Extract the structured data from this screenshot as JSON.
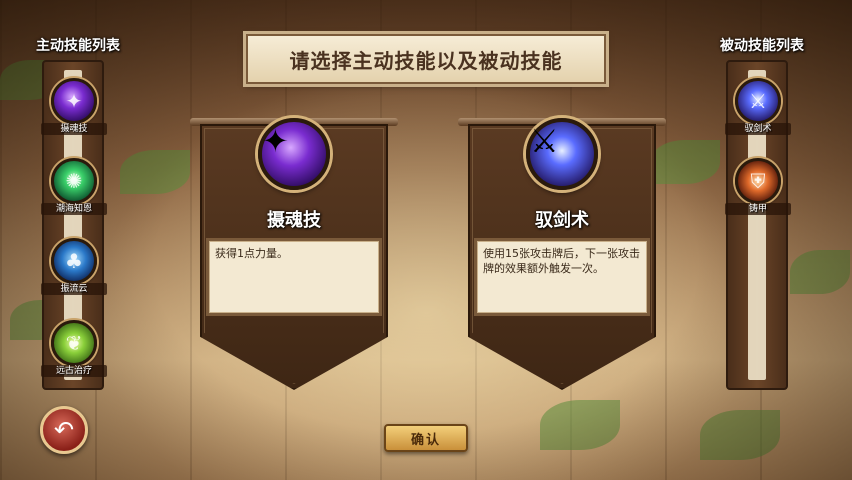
{
  "header": {
    "title": "请选择主动技能以及被动技能"
  },
  "active_list": {
    "heading": "主动技能列表",
    "items": [
      {
        "label": "摄魂技",
        "icon": "soul-claw-icon",
        "color": "#7a2cd0"
      },
      {
        "label": "潮海知恩",
        "icon": "green-burst-icon",
        "color": "#3ad06a"
      },
      {
        "label": "振流云",
        "icon": "blue-tree-icon",
        "color": "#2a78c8"
      },
      {
        "label": "远古治疗",
        "icon": "leaf-heal-icon",
        "color": "#8acf3a"
      }
    ]
  },
  "passive_list": {
    "heading": "被动技能列表",
    "items": [
      {
        "label": "驭剑术",
        "icon": "sword-icon",
        "color": "#5a6cff"
      },
      {
        "label": "铸甲",
        "icon": "armor-icon",
        "color": "#e06a2a"
      }
    ]
  },
  "selected_active": {
    "name": "摄魂技",
    "description": "获得1点力量。",
    "icon": "soul-claw-icon"
  },
  "selected_passive": {
    "name": "驭剑术",
    "description": "使用15张攻击牌后，下一张攻击牌的效果额外触发一次。",
    "icon": "sword-icon"
  },
  "buttons": {
    "confirm": "确认",
    "back": "back-arrow-icon"
  }
}
